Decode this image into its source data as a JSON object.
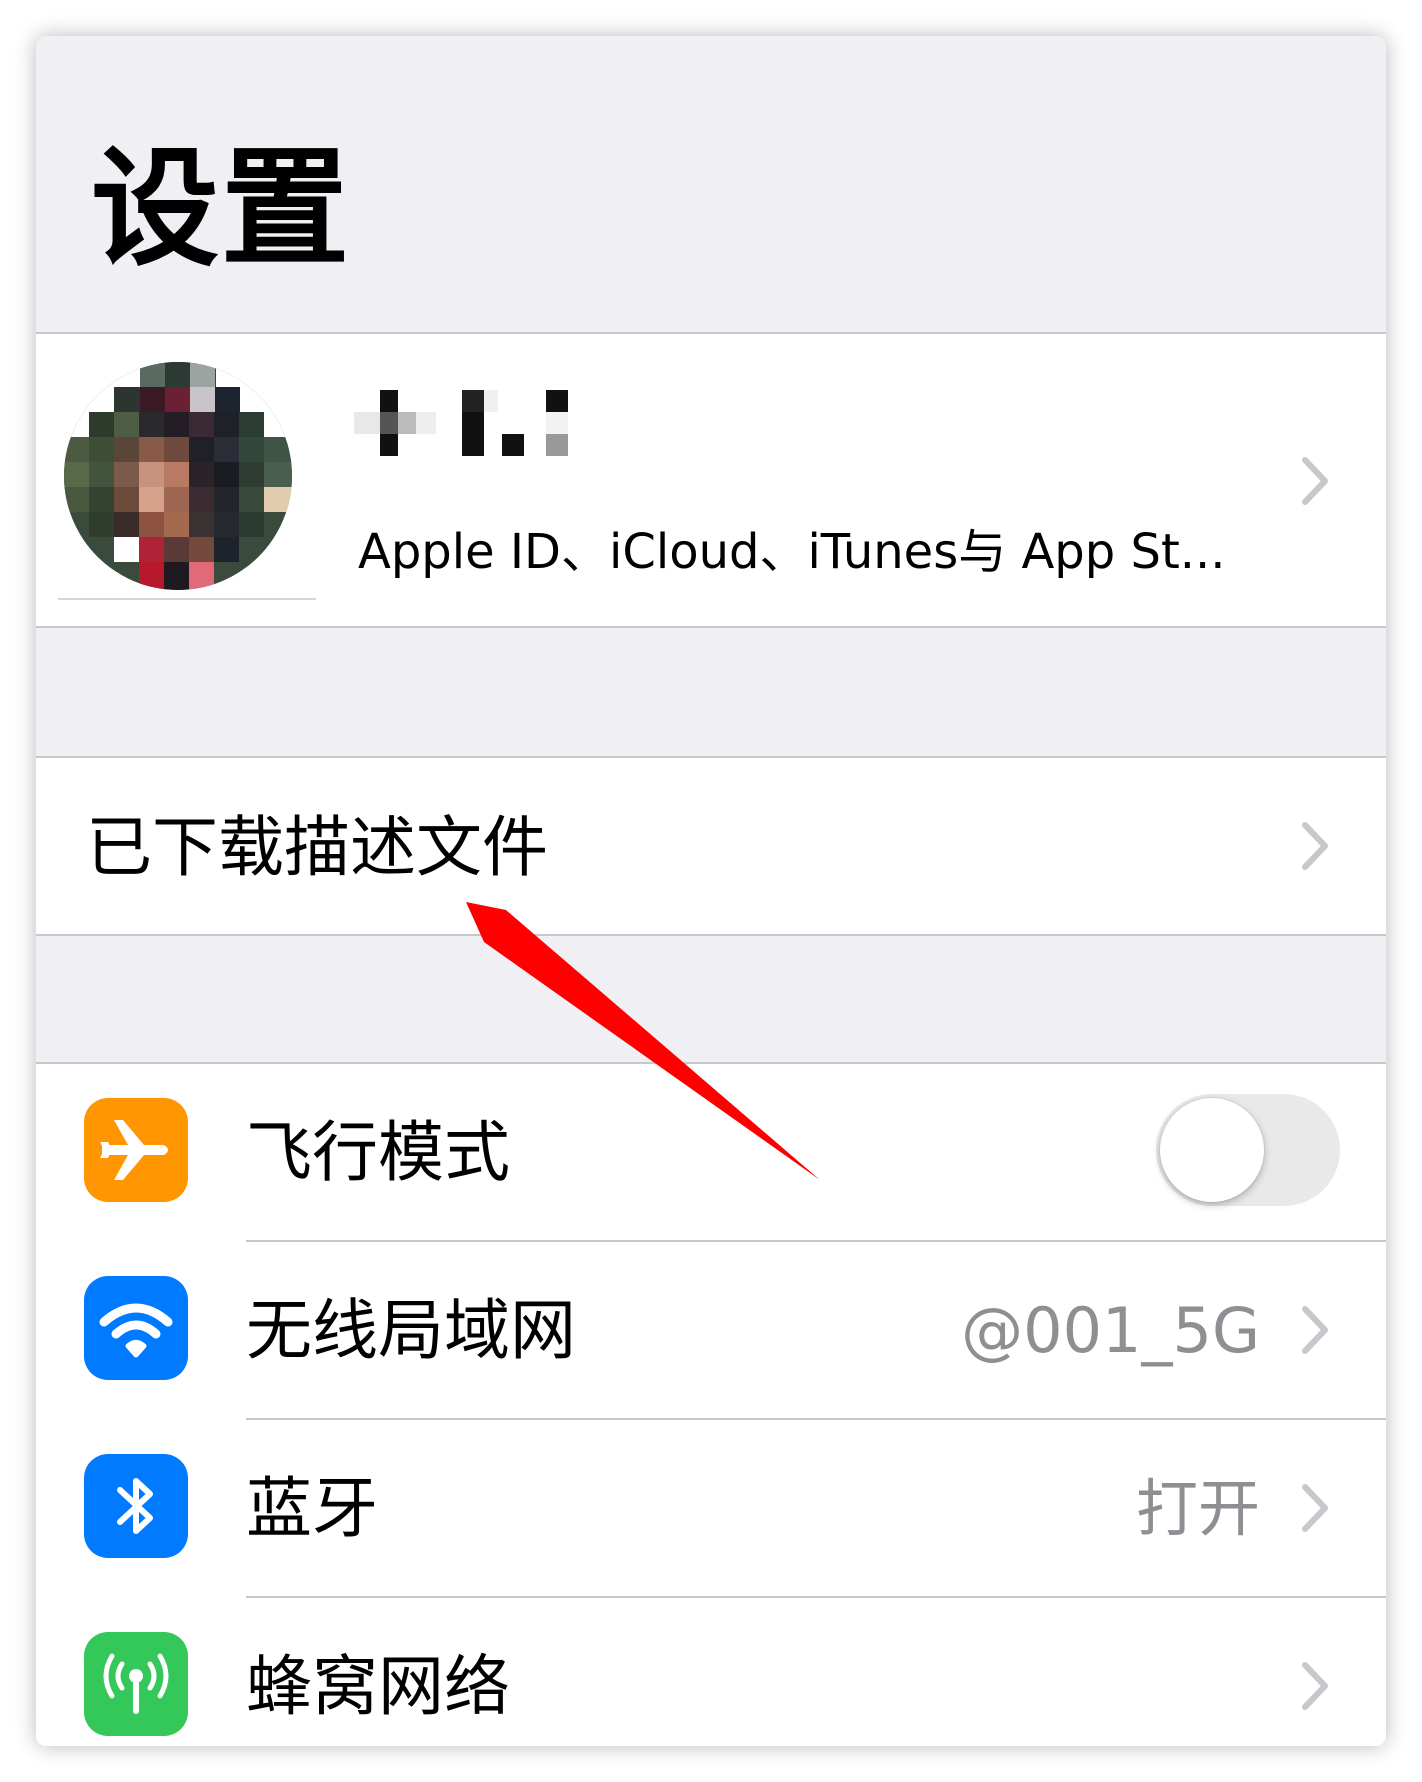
{
  "header": {
    "title": "设置"
  },
  "profile": {
    "subtitle": "Apple ID、iCloud、iTunes与 App St..."
  },
  "profiles_row": {
    "label": "已下载描述文件"
  },
  "settings": [
    {
      "label": "飞行模式",
      "icon": "airplane-icon",
      "icon_color": "#ff9500",
      "control": "toggle",
      "on": false
    },
    {
      "label": "无线局域网",
      "value": "@001_5G",
      "icon": "wifi-icon",
      "icon_color": "#007aff"
    },
    {
      "label": "蓝牙",
      "value": "打开",
      "icon": "bluetooth-icon",
      "icon_color": "#007aff"
    },
    {
      "label": "蜂窝网络",
      "icon": "cellular-icon",
      "icon_color": "#34c759"
    }
  ],
  "colors": {
    "annotation_arrow": "#ff0000",
    "background": "#efeff4",
    "separator": "#c8c7cc"
  }
}
